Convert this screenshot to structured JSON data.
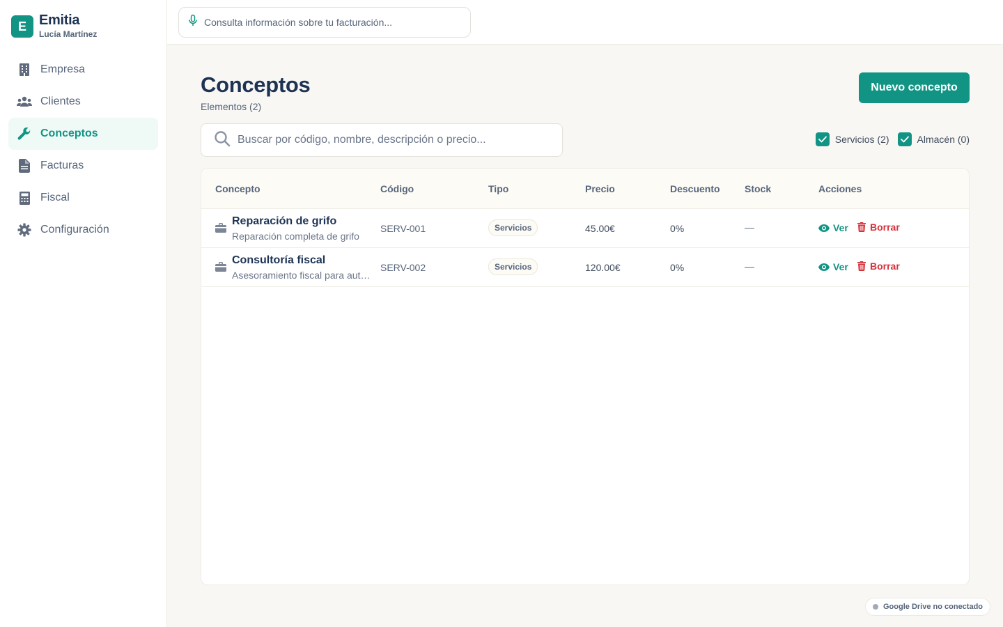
{
  "brand": {
    "logo_letter": "E",
    "name": "Emitia",
    "user": "Lucía Martínez"
  },
  "sidebar": {
    "items": [
      {
        "label": "Empresa",
        "icon": "building-icon",
        "active": false
      },
      {
        "label": "Clientes",
        "icon": "users-icon",
        "active": false
      },
      {
        "label": "Conceptos",
        "icon": "wrench-icon",
        "active": true
      },
      {
        "label": "Facturas",
        "icon": "file-icon",
        "active": false
      },
      {
        "label": "Fiscal",
        "icon": "calculator-icon",
        "active": false
      },
      {
        "label": "Configuración",
        "icon": "gear-icon",
        "active": false
      }
    ]
  },
  "topbar": {
    "assistant_placeholder": "Consulta información sobre tu facturación..."
  },
  "page": {
    "title": "Conceptos",
    "subtitle": "Elementos (2)",
    "new_button": "Nuevo concepto",
    "search_placeholder": "Buscar por código, nombre, descripción o precio...",
    "filters": [
      {
        "label": "Servicios (2)",
        "checked": true
      },
      {
        "label": "Almacén (0)",
        "checked": true
      }
    ]
  },
  "table": {
    "headers": [
      "Concepto",
      "Código",
      "Tipo",
      "Precio",
      "Descuento",
      "Stock",
      "Acciones"
    ],
    "rows": [
      {
        "name": "Reparación de grifo",
        "description": "Reparación completa de grifo",
        "code": "SERV-001",
        "type": "Servicios",
        "price": "45.00€",
        "discount": "0%",
        "stock": "—",
        "view": "Ver",
        "delete": "Borrar"
      },
      {
        "name": "Consultoría fiscal",
        "description": "Asesoramiento fiscal para autónomos",
        "code": "SERV-002",
        "type": "Servicios",
        "price": "120.00€",
        "discount": "0%",
        "stock": "—",
        "view": "Ver",
        "delete": "Borrar"
      }
    ]
  },
  "footer": {
    "gdrive_status": "Google Drive no conectado"
  },
  "colors": {
    "accent": "#129485",
    "danger": "#d6303c",
    "heading": "#1e3354",
    "muted": "#56657a",
    "background": "#f8f7f4"
  }
}
